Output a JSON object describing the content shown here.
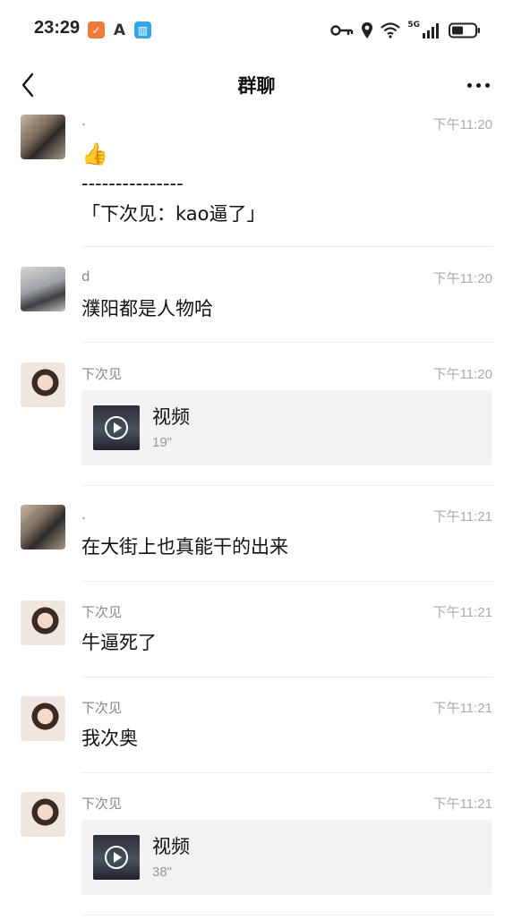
{
  "status_bar": {
    "time": "23:29",
    "network": "5G",
    "icons": [
      "app-orange-icon",
      "text-a-icon",
      "book-icon",
      "key-icon",
      "location-icon",
      "wifi-icon",
      "signal-icon",
      "battery-icon"
    ]
  },
  "nav": {
    "title": "群聊",
    "back_icon": "chevron-left-icon",
    "more_icon": "more-dots-icon"
  },
  "messages": [
    {
      "sender": ".",
      "time": "下午11:20",
      "emoji": "👍",
      "line1": "---------------",
      "line2": "「下次见：kao逼了」"
    },
    {
      "sender": "d",
      "time": "下午11:20",
      "text": "濮阳都是人物哈"
    },
    {
      "sender": "下次见",
      "time": "下午11:20",
      "video_title": "视频",
      "video_duration": "19\""
    },
    {
      "sender": ".",
      "time": "下午11:21",
      "text": "在大街上也真能干的出来"
    },
    {
      "sender": "下次见",
      "time": "下午11:21",
      "text": "牛逼死了"
    },
    {
      "sender": "下次见",
      "time": "下午11:21",
      "text": "我次奥"
    },
    {
      "sender": "下次见",
      "time": "下午11:21",
      "video_title": "视频",
      "video_duration": "38\""
    }
  ],
  "colors": {
    "background": "#ffffff",
    "meta_text": "#aaaaaa",
    "card_bg": "#f2f2f2"
  }
}
